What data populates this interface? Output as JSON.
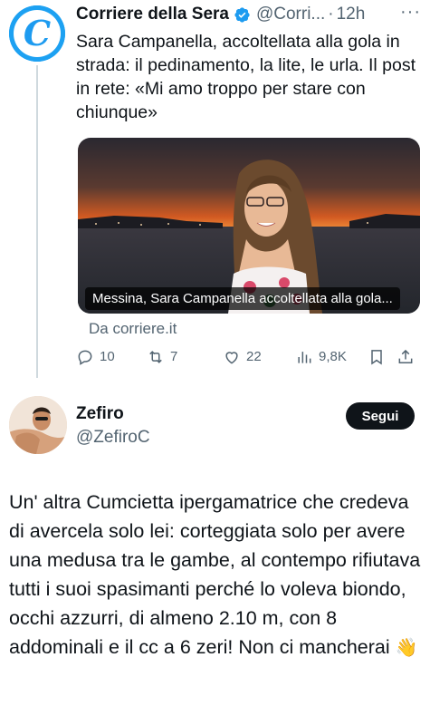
{
  "quoted": {
    "name": "Corriere della Sera",
    "handle": "@Corri...",
    "dot": "·",
    "time": "12h",
    "more": "···",
    "avatar_letter": "C",
    "text": "Sara Campanella, accoltellata alla gola in strada: il pedinamento, la lite, le urla. Il post in rete: «Mi amo troppo per stare con chiunque»",
    "media_caption": "Messina, Sara Campanella accoltellata alla gola...",
    "source": "Da corriere.it",
    "actions": {
      "replies": "10",
      "reposts": "7",
      "likes": "22",
      "views": "9,8K"
    }
  },
  "reply": {
    "name": "Zefiro",
    "handle": "@ZefiroC",
    "follow_label": "Segui",
    "text": "Un' altra Cumcietta ipergamatrice che credeva di avercela solo lei: corteggiata solo per avere una medusa tra le gambe, al contempo rifiutava tutti i suoi spasimanti perché lo voleva biondo, occhi azzurri, di almeno 2.10 m, con 8 addominali e il cc a 6 zeri! Non ci mancherai",
    "emoji": "👋"
  },
  "colors": {
    "accent": "#1d9bf0",
    "text": "#0f1419",
    "secondary": "#536471"
  }
}
